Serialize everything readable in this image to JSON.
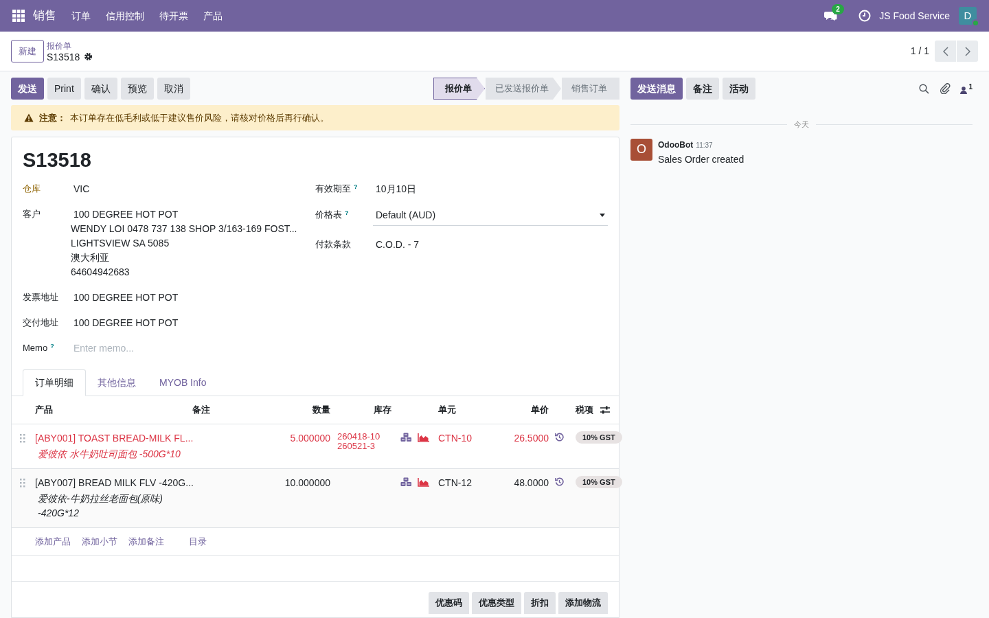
{
  "navbar": {
    "app_name": "销售",
    "menu": [
      "订单",
      "信用控制",
      "待开票",
      "产品"
    ],
    "messages_badge": "2",
    "company": "JS Food Service",
    "avatar": "D"
  },
  "control_panel": {
    "new_button": "新建",
    "breadcrumb": "报价单",
    "record": "S13518",
    "pager": "1 / 1"
  },
  "actions": [
    {
      "label": "发送",
      "primary": true
    },
    {
      "label": "Print",
      "primary": false
    },
    {
      "label": "确认",
      "primary": false
    },
    {
      "label": "预览",
      "primary": false
    },
    {
      "label": "取消",
      "primary": false
    }
  ],
  "stages": [
    {
      "label": "报价单",
      "selected": true
    },
    {
      "label": "已发送报价单",
      "selected": false
    },
    {
      "label": "销售订单",
      "selected": false
    }
  ],
  "alert": {
    "title": "注意：",
    "text": "本订单存在低毛利或低于建议售价风险，请核对价格后再行确认。"
  },
  "form": {
    "title": "S13518",
    "left_fields": [
      {
        "label": "仓库",
        "highlight": true,
        "lines": [
          "VIC"
        ]
      },
      {
        "label": "客户",
        "highlight": false,
        "lines": [
          "100 DEGREE HOT POT",
          "WENDY LOI 0478 737 138 SHOP 3/163-169 FOST...",
          "LIGHTSVIEW SA 5085",
          "澳大利亚",
          "64604942683"
        ]
      },
      {
        "label": "发票地址",
        "highlight": false,
        "lines": [
          "100 DEGREE HOT POT"
        ]
      },
      {
        "label": "交付地址",
        "highlight": false,
        "lines": [
          "100 DEGREE HOT POT"
        ]
      },
      {
        "label": "Memo",
        "highlight": false,
        "help": "?",
        "placeholder": "Enter memo..."
      }
    ],
    "right_fields": [
      {
        "label": "有效期至",
        "help": "?",
        "kind": "text",
        "value": "10月10日"
      },
      {
        "label": "价格表",
        "help": "?",
        "kind": "select",
        "value": "Default (AUD)"
      },
      {
        "label": "付款条款",
        "kind": "text",
        "value": "C.O.D. - 7"
      }
    ]
  },
  "tabs": [
    {
      "label": "订单明细",
      "selected": true
    },
    {
      "label": "其他信息",
      "selected": false
    },
    {
      "label": "MYOB Info",
      "selected": false
    }
  ],
  "table": {
    "columns": [
      "产品",
      "备注",
      "数量",
      "库存",
      "单元",
      "单价",
      "税项"
    ],
    "rows": [
      {
        "warning": true,
        "product": "[ABY001] TOAST BREAD-MILK FL...",
        "description": [
          "爱彼依 水牛奶吐司面包 -500G*10"
        ],
        "quantity": "5.000000",
        "stock": [
          "260418-10",
          "260521-3"
        ],
        "unit": "CTN-10",
        "price": "26.5000",
        "tax": "10% GST"
      },
      {
        "warning": false,
        "product": "[ABY007] BREAD MILK FLV -420G...",
        "description": [
          "爱彼依-牛奶拉丝老面包(原味)",
          "-420G*12"
        ],
        "quantity": "10.000000",
        "stock": [],
        "unit": "CTN-12",
        "price": "48.0000",
        "tax": "10% GST"
      }
    ],
    "add_links": [
      "添加产品",
      "添加小节",
      "添加备注",
      "目录"
    ]
  },
  "footer_buttons": [
    "优惠码",
    "优惠类型",
    "折扣",
    "添加物流"
  ],
  "chatter": {
    "buttons": [
      {
        "label": "发送消息",
        "primary": true
      },
      {
        "label": "备注",
        "primary": false
      },
      {
        "label": "活动",
        "primary": false
      }
    ],
    "followers": "1",
    "date_separator": "今天",
    "messages": [
      {
        "avatar": "O",
        "author": "OdooBot",
        "time": "11:37",
        "body": "Sales Order created"
      }
    ]
  }
}
